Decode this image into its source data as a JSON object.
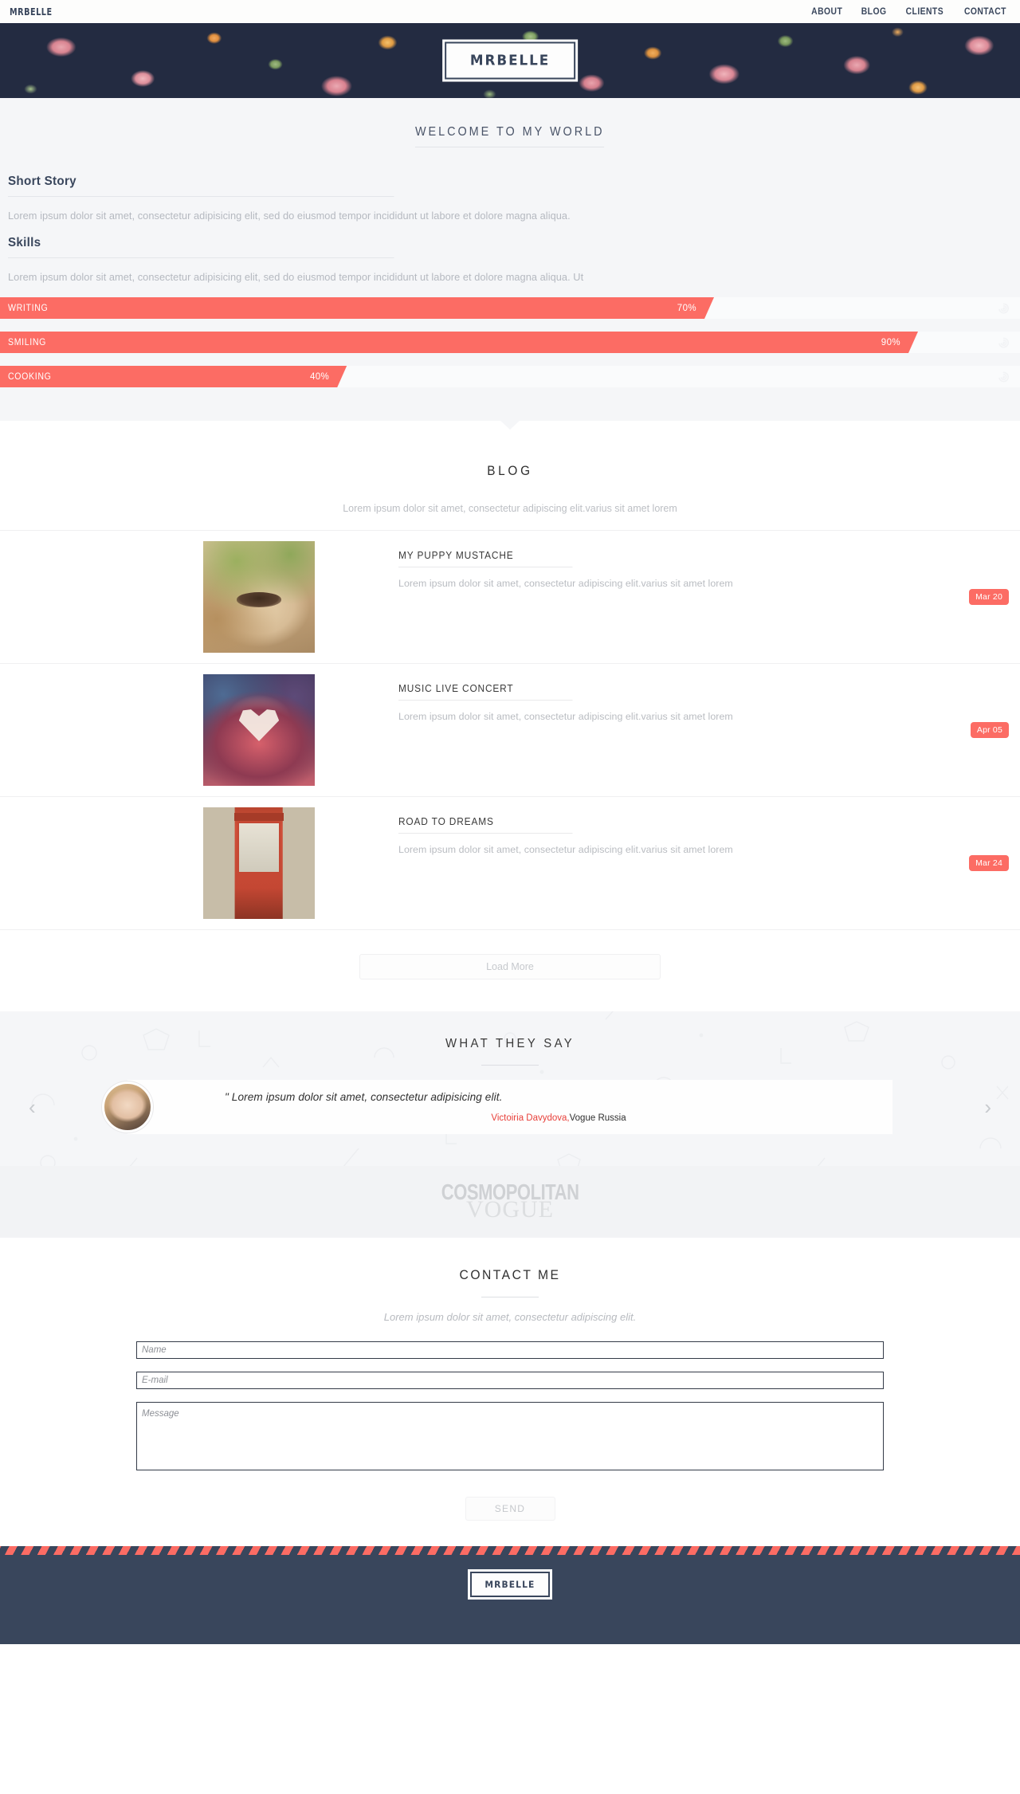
{
  "nav": {
    "brand": "MRBELLE",
    "links": [
      {
        "label": "ABOUT"
      },
      {
        "label": "BLOG"
      },
      {
        "label": "CLIENTS"
      },
      {
        "label": "CONTACT"
      }
    ]
  },
  "hero": {
    "logo": "MRBELLE"
  },
  "about": {
    "section_title": "WELCOME TO MY WORLD",
    "short_story_heading": "Short Story",
    "short_story_text": "Lorem ipsum dolor sit amet, consectetur adipisicing elit, sed do eiusmod tempor incididunt ut labore et dolore magna aliqua.",
    "skills_heading": "Skills",
    "skills_text": "Lorem ipsum dolor sit amet, consectetur adipisicing elit, sed do eiusmod tempor incididunt ut labore et dolore magna aliqua. Ut",
    "skills": [
      {
        "name": "WRITING",
        "percent": 70,
        "percent_label": "70%"
      },
      {
        "name": "SMILING",
        "percent": 90,
        "percent_label": "90%"
      },
      {
        "name": "COOKING",
        "percent": 40,
        "percent_label": "40%"
      }
    ]
  },
  "blog": {
    "title": "BLOG",
    "subtitle": "Lorem ipsum dolor sit amet, consectetur adipiscing elit.varius sit amet lorem",
    "posts": [
      {
        "title": "MY PUPPY MUSTACHE",
        "excerpt": "Lorem ipsum dolor sit amet, consectetur adipiscing elit.varius sit amet lorem",
        "date": "Mar 20",
        "thumb": "puppy-mustache-photo"
      },
      {
        "title": "MUSIC LIVE CONCERT",
        "excerpt": "Lorem ipsum dolor sit amet, consectetur adipiscing elit.varius sit amet lorem",
        "date": "Apr 05",
        "thumb": "concert-hands-heart-photo"
      },
      {
        "title": "ROAD TO DREAMS",
        "excerpt": "Lorem ipsum dolor sit amet, consectetur adipiscing elit.varius sit amet lorem",
        "date": "Mar 24",
        "thumb": "red-phone-box-photo"
      }
    ],
    "load_more": "Load More"
  },
  "testimonials": {
    "title": "WHAT THEY SAY",
    "prev_icon": "chevron-left-icon",
    "next_icon": "chevron-right-icon",
    "items": [
      {
        "quote": "\" Lorem ipsum dolor sit amet, consectetur adipisicing elit.",
        "author_name": "Victoiria Davydova,",
        "author_company": "Vogue Russia",
        "avatar": "woman-portrait-photo"
      }
    ]
  },
  "clients": {
    "logos": [
      {
        "name": "COSMOPOLITAN"
      },
      {
        "name": "VOGUE"
      }
    ]
  },
  "contact": {
    "title": "CONTACT ME",
    "subtitle": "Lorem ipsum dolor sit amet, consectetur adipiscing elit.",
    "name_placeholder": "Name",
    "name_value": "",
    "email_placeholder": "E-mail",
    "email_value": "",
    "message_placeholder": "Message",
    "message_value": "",
    "send_label": "SEND"
  },
  "footer": {
    "logo": "MRBELLE"
  },
  "colors": {
    "accent": "#fc6c64",
    "navy": "#39465c",
    "page_bg": "#ffffff",
    "panel_bg": "#f5f6f8",
    "muted_text": "#b9bcc1"
  }
}
